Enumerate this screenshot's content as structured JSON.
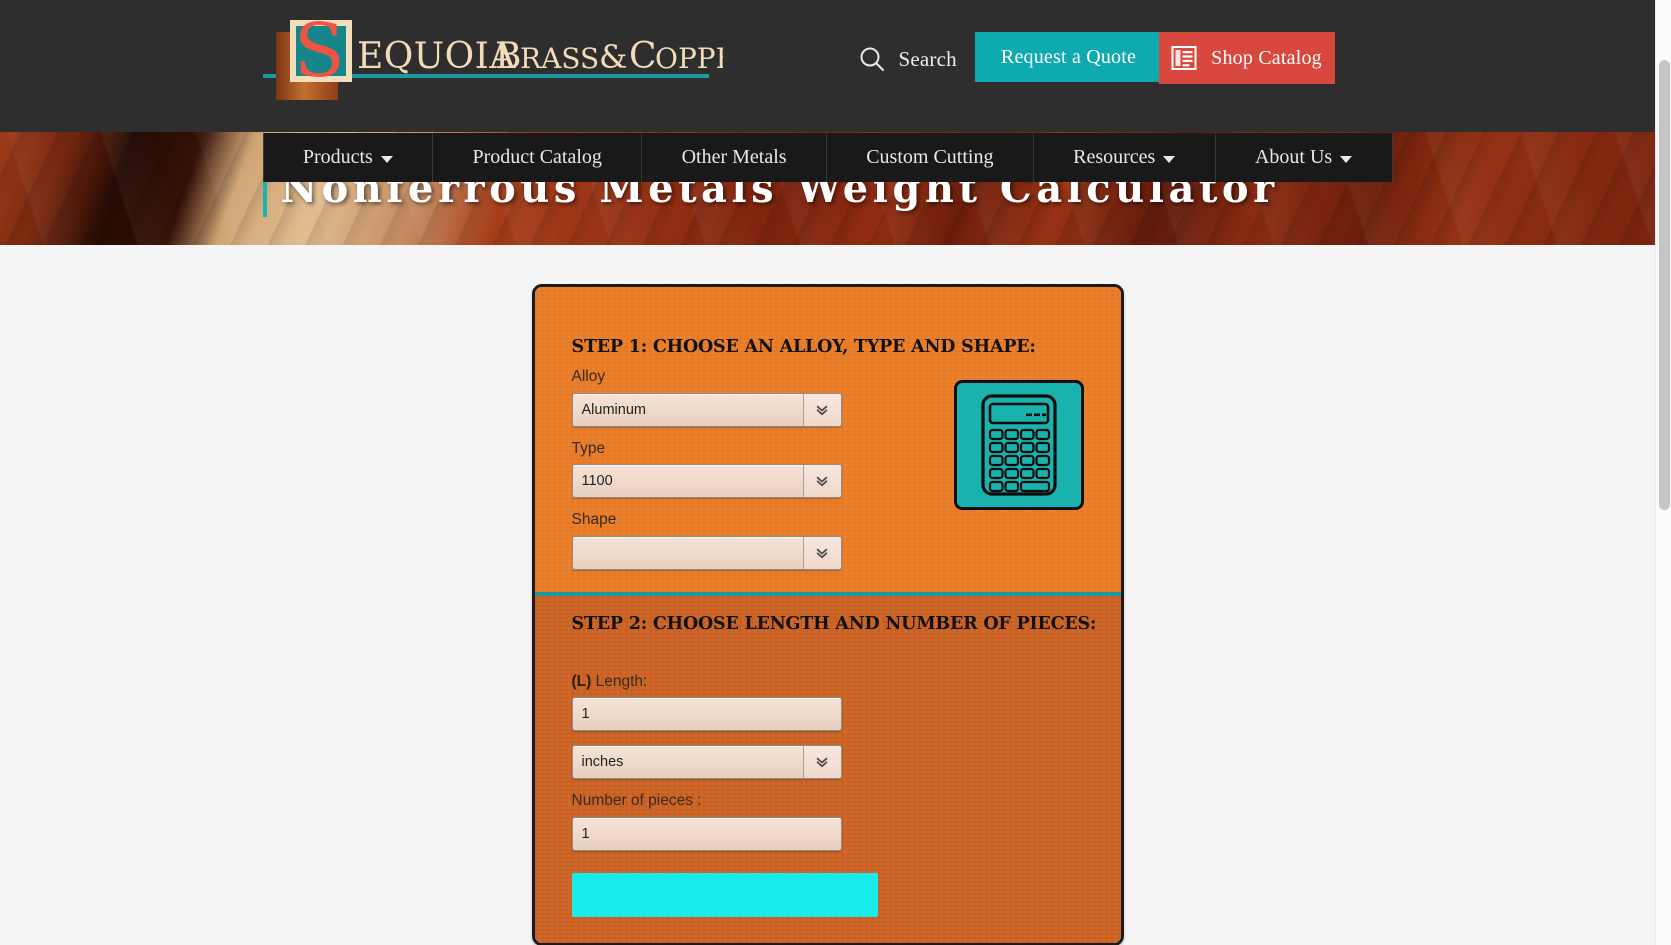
{
  "header": {
    "logo": {
      "monogram": "S",
      "wordmark": "EQUOIA BRASS & COPPER",
      "alt": "Sequoia Brass & Copper"
    },
    "search_label": "Search",
    "search_icon": "search-icon",
    "quote_button": "Request a Quote",
    "shop_button": "Shop Catalog",
    "shop_icon": "catalog-list-icon",
    "colors": {
      "bar": "#2e2e2e",
      "quote": "#0fa9b0",
      "shop": "#d9483e",
      "logo_teal": "#1b8f8f",
      "logo_red": "#e8503c",
      "logo_cream": "#f3d9b7"
    }
  },
  "nav": {
    "items": [
      {
        "label": "Products",
        "has_caret": true
      },
      {
        "label": "Product Catalog",
        "has_caret": false
      },
      {
        "label": "Other Metals",
        "has_caret": false
      },
      {
        "label": "Custom Cutting",
        "has_caret": false
      },
      {
        "label": "Resources",
        "has_caret": true
      },
      {
        "label": "About Us",
        "has_caret": true
      }
    ]
  },
  "hero": {
    "title": "Nonferrous Metals Weight Calculator",
    "accent_color": "#16b4b4"
  },
  "calculator": {
    "step1": {
      "title": "STEP 1: CHOOSE AN ALLOY, TYPE AND SHAPE:",
      "bg_color": "#ed7d27",
      "fields": [
        {
          "label": "Alloy",
          "value": "Aluminum",
          "control": "select"
        },
        {
          "label": "Type",
          "value": "1100",
          "control": "select"
        },
        {
          "label": "Shape",
          "value": "",
          "control": "select"
        }
      ],
      "icon": "calculator-icon",
      "icon_color": "#19b2ad"
    },
    "step2": {
      "title": "STEP 2: CHOOSE LENGTH AND NUMBER OF PIECES:",
      "bg_color": "#ce6424",
      "length_label_bold": "(L)",
      "length_label_rest": " Length:",
      "length_value": "1",
      "unit_value": "inches",
      "pieces_label": "Number of pieces :",
      "pieces_value": "1",
      "calculate_button": "",
      "calculate_color": "#19ecec"
    }
  },
  "scrollbar": {
    "thumb_color": "#c6c6c6"
  }
}
